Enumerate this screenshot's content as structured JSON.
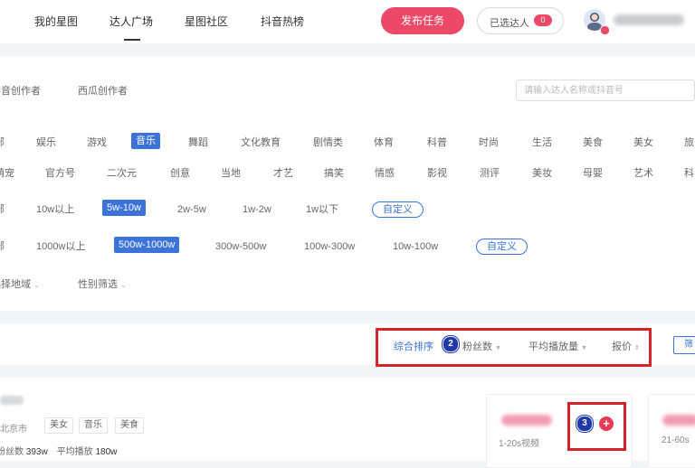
{
  "header": {
    "nav": [
      "我的星图",
      "达人广场",
      "星图社区",
      "抖音热榜"
    ],
    "publish_label": "发布任务",
    "selected_label": "已选达人",
    "selected_count": "0",
    "colors": {
      "accent": "#ec4868",
      "primary": "#3b73d9"
    }
  },
  "filters": {
    "tabs": [
      "抖音创作者",
      "西瓜创作者"
    ],
    "search_placeholder": "请输入达人名称或抖音号",
    "row1": [
      "全部",
      "娱乐",
      "游戏",
      "音乐",
      "舞蹈",
      "文化教育",
      "剧情类",
      "体育",
      "科普",
      "时尚",
      "生活",
      "美食",
      "美女",
      "旅"
    ],
    "row2": [
      "萌宠",
      "官方号",
      "二次元",
      "创意",
      "当地",
      "才艺",
      "搞笑",
      "情感",
      "影视",
      "测评",
      "美妆",
      "母婴",
      "艺术",
      "科"
    ],
    "row3": [
      "全部",
      "10w以上",
      "5w-10w",
      "2w-5w",
      "1w-2w",
      "1w以下"
    ],
    "row3_custom": "自定义",
    "row4": [
      "全部",
      "1000w以上",
      "500w-1000w",
      "300w-500w",
      "100w-300w",
      "10w-100w"
    ],
    "row4_custom": "自定义",
    "dropdowns": [
      "选择地域",
      "性别筛选"
    ]
  },
  "sort": {
    "items": [
      "综合排序",
      "粉丝数",
      "平均播放量",
      "报价"
    ],
    "markers": [
      "2",
      "3"
    ],
    "right_action": "筛"
  },
  "result": {
    "location": "北京市",
    "tags": [
      "美女",
      "音乐",
      "美食"
    ],
    "fans_label": "粉丝数",
    "fans_value": "393w",
    "avg_play_label": "平均播放",
    "avg_play_value": "180w",
    "price_label_1": "1-20s视频",
    "price_label_2": "21-60s"
  }
}
